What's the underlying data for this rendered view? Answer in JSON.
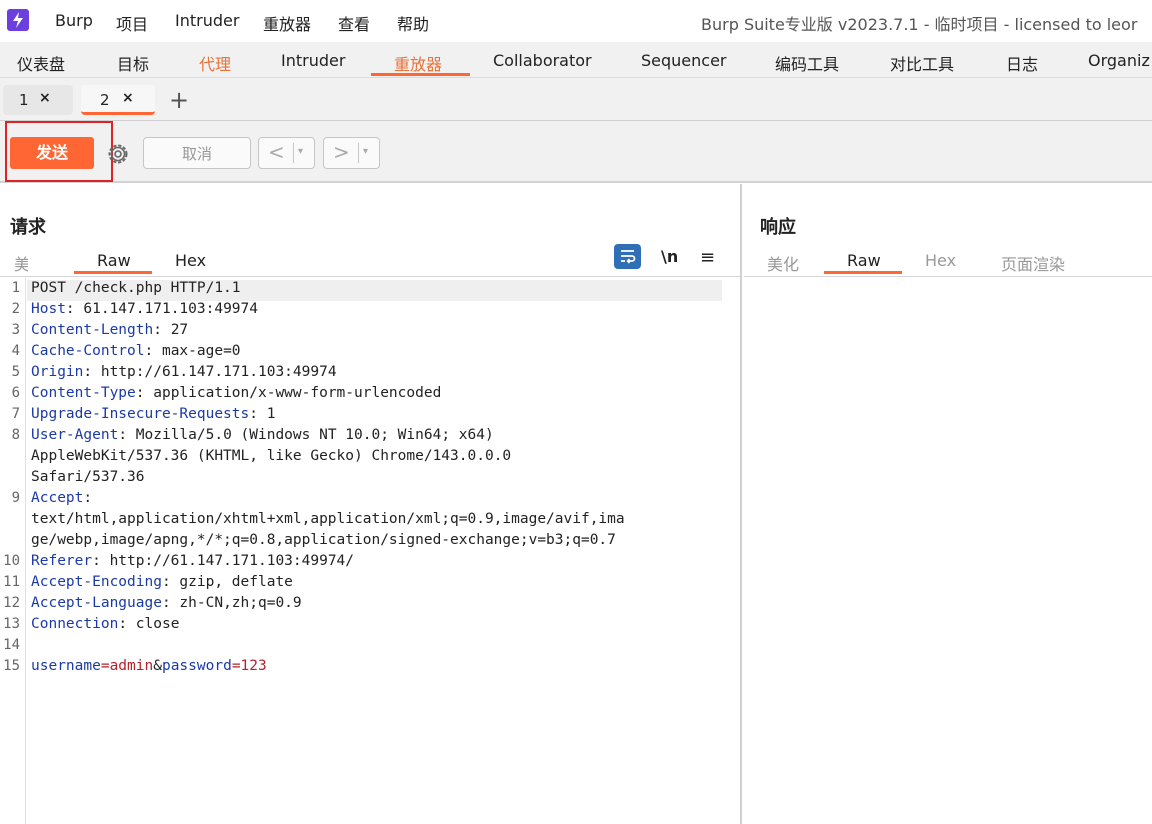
{
  "menubar": {
    "items": [
      "Burp",
      "项目",
      "Intruder",
      "重放器",
      "查看",
      "帮助"
    ],
    "title": "Burp Suite专业版  v2023.7.1 - 临时项目 - licensed to leor"
  },
  "main_tabs": [
    "仪表盘",
    "目标",
    "代理",
    "Intruder",
    "重放器",
    "Collaborator",
    "Sequencer",
    "编码工具",
    "对比工具",
    "日志",
    "Organiz"
  ],
  "sub_tabs": [
    {
      "label": "1",
      "close": "×"
    },
    {
      "label": "2",
      "close": "×"
    }
  ],
  "sub_tabs_add": "+",
  "toolbar": {
    "send_label": "发送",
    "cancel_label": "取消",
    "prev_label": "<",
    "next_label": ">",
    "dropdown": "▾"
  },
  "request": {
    "title": "请求",
    "tabs": [
      "美",
      "Raw",
      "Hex"
    ],
    "nl_label": "\\n",
    "menu_label": "≡"
  },
  "response": {
    "title": "响应",
    "tabs": [
      "美化",
      "Raw",
      "Hex",
      "页面渲染"
    ]
  },
  "code_lines": [
    {
      "n": "1",
      "text": "POST /check.php HTTP/1.1"
    },
    {
      "n": "2",
      "key": "Host",
      "sep": ": ",
      "val": "61.147.171.103:49974"
    },
    {
      "n": "3",
      "key": "Content-Length",
      "sep": ": ",
      "val": "27"
    },
    {
      "n": "4",
      "key": "Cache-Control",
      "sep": ": ",
      "val": "max-age=0"
    },
    {
      "n": "5",
      "key": "Origin",
      "sep": ": ",
      "val": "http://61.147.171.103:49974"
    },
    {
      "n": "6",
      "key": "Content-Type",
      "sep": ": ",
      "val": "application/x-www-form-urlencoded"
    },
    {
      "n": "7",
      "key": "Upgrade-Insecure-Requests",
      "sep": ": ",
      "val": "1"
    },
    {
      "n": "8",
      "key": "User-Agent",
      "sep": ": ",
      "val": "Mozilla/5.0 (Windows NT 10.0; Win64; x64)"
    },
    {
      "n": "",
      "text": "AppleWebKit/537.36 (KHTML, like Gecko) Chrome/143.0.0.0"
    },
    {
      "n": "",
      "text": "Safari/537.36"
    },
    {
      "n": "9",
      "key": "Accept",
      "sep": ":",
      "val": ""
    },
    {
      "n": "",
      "text": "text/html,application/xhtml+xml,application/xml;q=0.9,image/avif,ima"
    },
    {
      "n": "",
      "text": "ge/webp,image/apng,*/*;q=0.8,application/signed-exchange;v=b3;q=0.7"
    },
    {
      "n": "10",
      "key": "Referer",
      "sep": ": ",
      "val": "http://61.147.171.103:49974/"
    },
    {
      "n": "11",
      "key": "Accept-Encoding",
      "sep": ": ",
      "val": "gzip, deflate"
    },
    {
      "n": "12",
      "key": "Accept-Language",
      "sep": ": ",
      "val": "zh-CN,zh;q=0.9"
    },
    {
      "n": "13",
      "key": "Connection",
      "sep": ": ",
      "val": "close"
    },
    {
      "n": "14",
      "text": ""
    },
    {
      "n": "15",
      "body": [
        {
          "t": "username",
          "c": "k"
        },
        {
          "t": "=",
          "c": "v"
        },
        {
          "t": "admin",
          "c": "v"
        },
        {
          "t": "&",
          "c": ""
        },
        {
          "t": "password",
          "c": "k"
        },
        {
          "t": "=",
          "c": "v"
        },
        {
          "t": "123",
          "c": "v"
        }
      ]
    }
  ]
}
